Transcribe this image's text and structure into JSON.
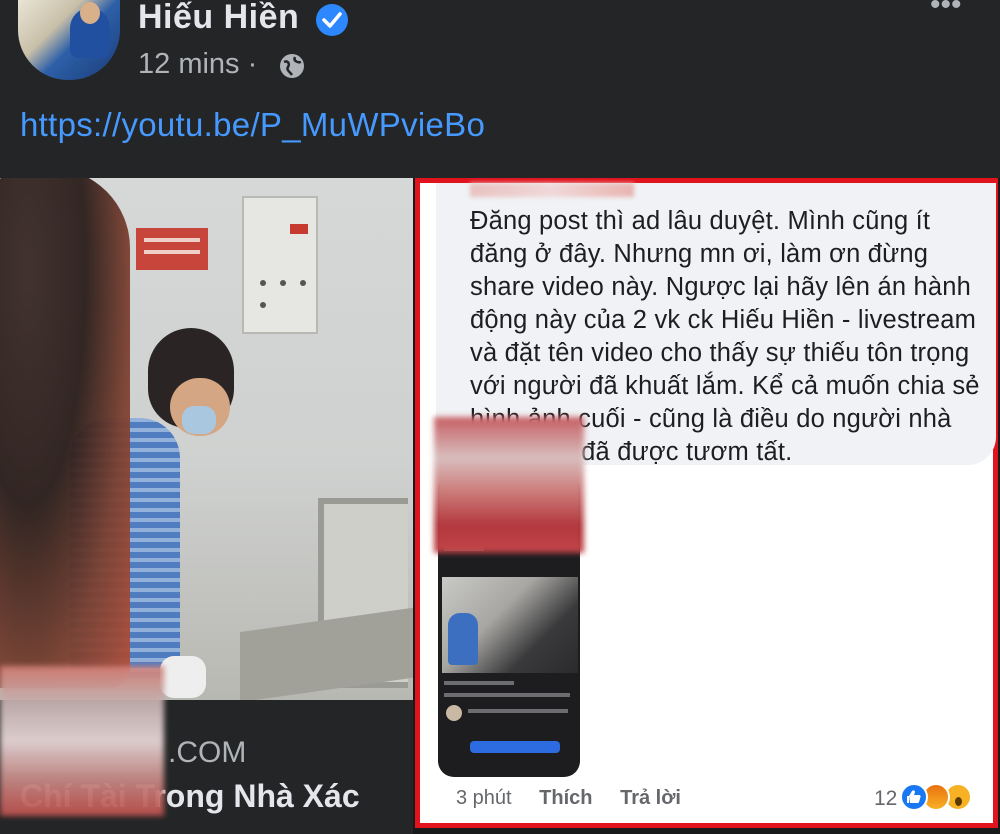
{
  "post": {
    "author": "Hiếu Hiền",
    "verified_icon": "verified-badge-icon",
    "time": "12 mins ·",
    "privacy_icon": "globe-icon",
    "more_icon": "more-options-icon",
    "link": "https://youtu.be/P_MuWPvieBo"
  },
  "video_preview": {
    "domain": ".COM",
    "title": "Chí Tài Trong Nhà Xác"
  },
  "comment": {
    "text": "Đăng post thì ad lâu duyệt. Mình cũng ít đăng ở đây. Nhưng mn ơi, làm ơn đừng share video này. Ngược lại hãy lên án hành động này của 2 vk ck Hiếu Hiền - livestream và đặt tên video cho thấy sự thiếu tôn trọng với người đã khuất lắm. Kể cả muốn chia sẻ hình ảnh cuối - cũng là điều do người nhà          và khi họ đã được tươm tất.",
    "time": "3 phút",
    "like_label": "Thích",
    "reply_label": "Trả lời",
    "reaction_count": "12",
    "reactions": [
      "like",
      "angry",
      "wow"
    ]
  },
  "colors": {
    "link": "#4599ff",
    "highlight_border": "#e1141e",
    "verified": "#2d88ff"
  }
}
